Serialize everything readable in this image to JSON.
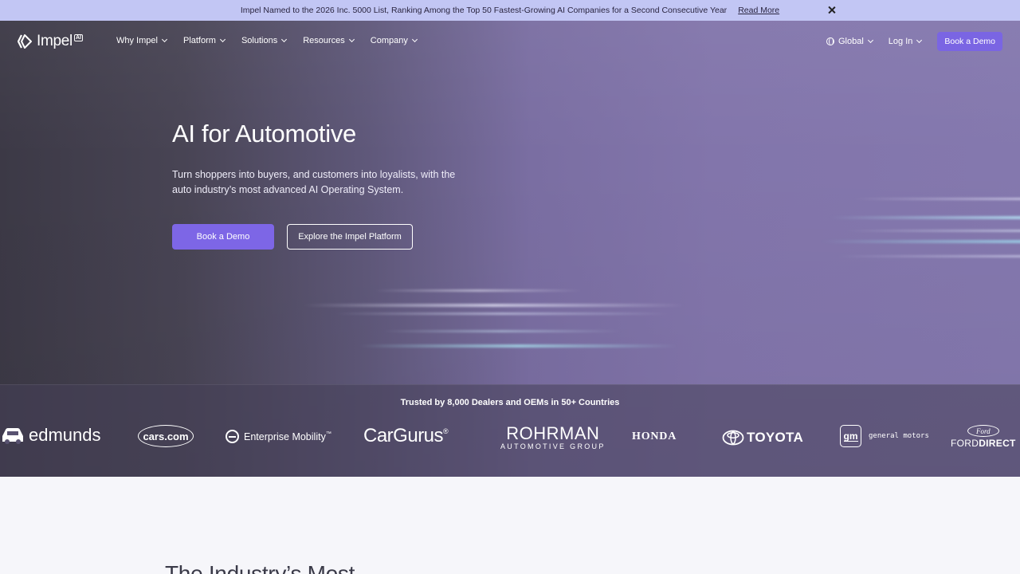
{
  "announcement": {
    "message": "Impel Named to the 2026 Inc. 5000 List, Ranking Among the Top 50 Fastest-Growing AI Companies for a Second Consecutive Year",
    "link_label": "Read More"
  },
  "nav": {
    "logo_text": "Impel",
    "logo_badge": "AI",
    "items": [
      {
        "label": "Why Impel"
      },
      {
        "label": "Platform"
      },
      {
        "label": "Solutions"
      },
      {
        "label": "Resources"
      },
      {
        "label": "Company"
      }
    ],
    "global_label": "Global",
    "login_label": "Log In",
    "demo_label": "Book a Demo"
  },
  "hero": {
    "headline": "AI for Automotive",
    "subtext": "Turn shoppers into buyers, and customers into loyalists, with the auto industry’s most advanced AI Operating System.",
    "primary_cta": "Book a Demo",
    "secondary_cta": "Explore the Impel Platform"
  },
  "trust": {
    "title": "Trusted by 8,000 Dealers and OEMs in 50+ Countries",
    "logos": {
      "edmunds": "edmunds",
      "cars": "cars.com",
      "enterprise": "Enterprise Mobility",
      "enterprise_tm": "™",
      "cargurus": "CarGurus",
      "cargurus_reg": "®",
      "rohrman_main": "ROHRMAN",
      "rohrman_sub": "AUTOMOTIVE GROUP",
      "honda": "HONDA",
      "toyota": "TOYOTA",
      "gm_badge": "gm",
      "gm_text": "general motors",
      "ford_badge": "Ford",
      "ford_text_a": "FORD",
      "ford_text_b": "DIRECT"
    }
  },
  "section": {
    "heading": "The Industry’s Most"
  },
  "colors": {
    "announcement_bg": "#c2c6f4",
    "accent": "#7d66e6",
    "bottom_bg": "#f6f6fa"
  }
}
